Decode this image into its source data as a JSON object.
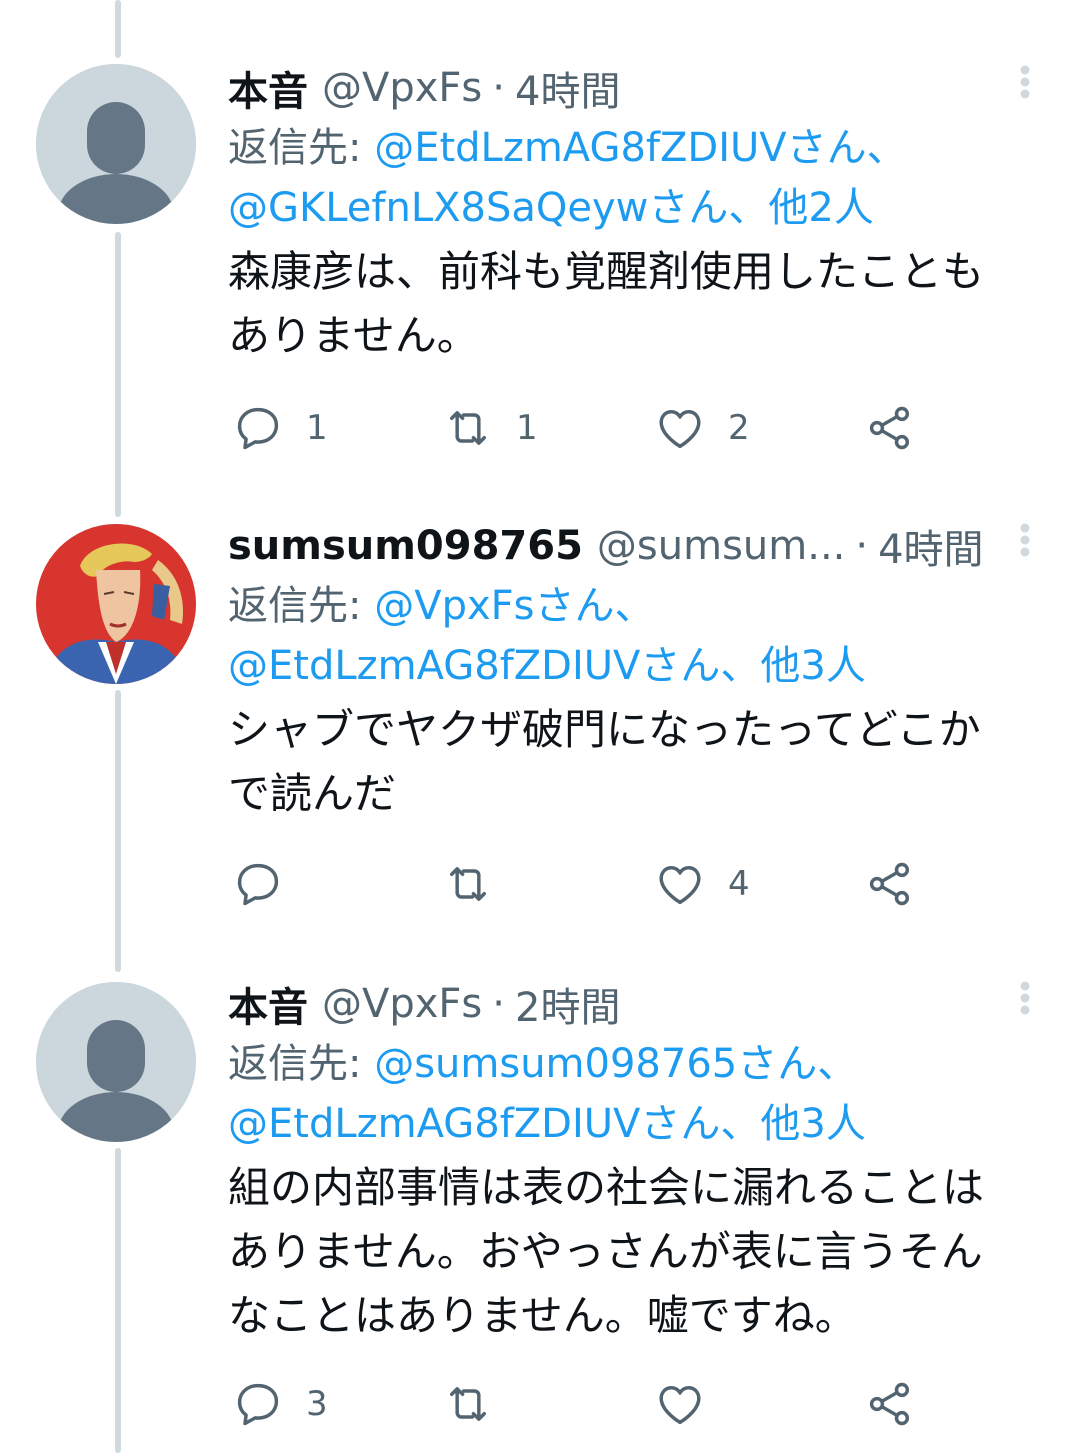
{
  "tweets": [
    {
      "name": "本音",
      "handle": "@VpxFs",
      "separator": "·",
      "time": "4時間",
      "reply_label": "返信先:",
      "reply_line1": "@EtdLzmAG8fZDIUVさん、",
      "reply_line2": "@GKLefnLX8SaQeywさん、他2人",
      "text_line1": "森康彦は、前科も覚醒剤使用したことも",
      "text_line2": "ありません。",
      "text_line3": "",
      "reply_count": "1",
      "retweet_count": "1",
      "like_count": "2",
      "avatar": "default-avatar-icon"
    },
    {
      "name": "sumsum098765",
      "handle": "@sumsum...",
      "separator": "·",
      "time": "4時間",
      "reply_label": "返信先:",
      "reply_line1": "@VpxFsさん、",
      "reply_line2": "@EtdLzmAG8fZDIUVさん、他3人",
      "text_line1": "シャブでヤクザ破門になったってどこか",
      "text_line2": "で読んだ",
      "text_line3": "",
      "reply_count": "",
      "retweet_count": "",
      "like_count": "4",
      "avatar": "illustrated-portrait-avatar"
    },
    {
      "name": "本音",
      "handle": "@VpxFs",
      "separator": "·",
      "time": "2時間",
      "reply_label": "返信先:",
      "reply_line1": "@sumsum098765さん、",
      "reply_line2": "@EtdLzmAG8fZDIUVさん、他3人",
      "text_line1": "組の内部事情は表の社会に漏れることは",
      "text_line2": "ありません。おやっさんが表に言うそん",
      "text_line3": "なことはありません。嘘ですね。",
      "reply_count": "3",
      "retweet_count": "",
      "like_count": "",
      "avatar": "default-avatar-icon"
    }
  ],
  "colors": {
    "text": "#0f1419",
    "secondary": "#536471",
    "link": "#1d9bf0",
    "thread_line": "#cfd9de",
    "avatar_bg": "#ccd6dd",
    "avatar_figure": "#657786"
  }
}
